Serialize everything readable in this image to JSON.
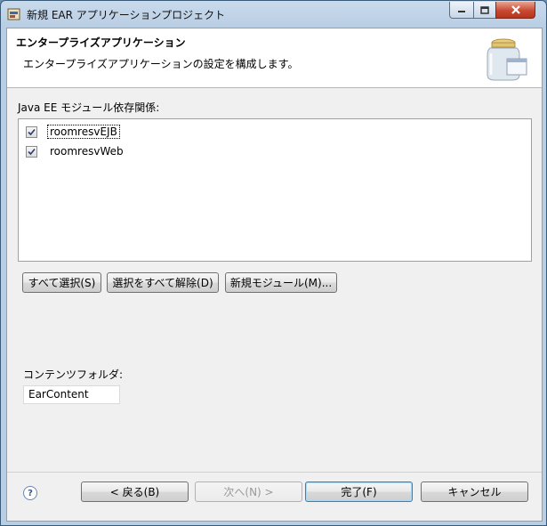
{
  "window": {
    "title": "新規 EAR アプリケーションプロジェクト"
  },
  "banner": {
    "title": "エンタープライズアプリケーション",
    "description": "エンタープライズアプリケーションの設定を構成します。"
  },
  "modules": {
    "label": "Java EE モジュール依存関係:",
    "items": [
      {
        "label": "roomresvEJB",
        "checked": true
      },
      {
        "label": "roomresvWeb",
        "checked": true
      }
    ],
    "buttons": {
      "select_all": "すべて選択(S)",
      "deselect_all": "選択をすべて解除(D)",
      "new_module": "新規モジュール(M)..."
    }
  },
  "content_folder": {
    "label": "コンテンツフォルダ:",
    "value": "EarContent"
  },
  "footer": {
    "back": "< 戻る(B)",
    "next": "次へ(N) >",
    "finish": "完了(F)",
    "cancel": "キャンセル",
    "help_glyph": "?"
  }
}
